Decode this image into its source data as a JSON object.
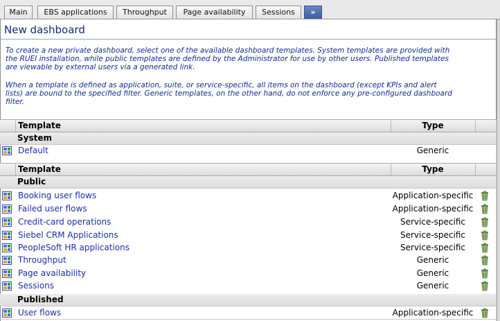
{
  "tabs": [
    {
      "label": "Main"
    },
    {
      "label": "EBS applications"
    },
    {
      "label": "Throughput"
    },
    {
      "label": "Page availability"
    },
    {
      "label": "Sessions"
    },
    {
      "label": "»"
    }
  ],
  "page": {
    "title": "New dashboard",
    "desc1_lines": [
      "To create a new private dashboard, select one of the available dashboard templates. System templates are provided with",
      "the RUEI installation, while public templates are defined by the Administrator for use by other users. Published templates",
      "are viewable by external users via a generated link."
    ],
    "desc2_lines": [
      "When a template is defined as application, suite, or service-specific, all items on the dashboard (except KPIs and alert",
      "lists) are bound to the specified filter. Generic templates, on the other hand, do not enforce any pre-configured dashboard",
      "filter."
    ]
  },
  "table": {
    "col_template": "Template",
    "col_type": "Type",
    "system_group": "System",
    "system_rows": [
      {
        "name": "Default",
        "type": "Generic"
      }
    ],
    "public_group": "Public",
    "public_rows": [
      {
        "name": "Booking user flows",
        "type": "Application-specific"
      },
      {
        "name": "Failed user flows",
        "type": "Application-specific"
      },
      {
        "name": "Credit-card operations",
        "type": "Service-specific"
      },
      {
        "name": "Siebel CRM Applications",
        "type": "Service-specific"
      },
      {
        "name": "PeopleSoft HR applications",
        "type": "Service-specific"
      },
      {
        "name": "Throughput",
        "type": "Generic"
      },
      {
        "name": "Page availability",
        "type": "Generic"
      },
      {
        "name": "Sessions",
        "type": "Generic"
      }
    ],
    "published_group": "Published",
    "published_rows": [
      {
        "name": "User flows",
        "type": "Application-specific"
      }
    ]
  },
  "icons": {
    "dashboard": "dashboard-icon",
    "delete": "trash-icon"
  }
}
